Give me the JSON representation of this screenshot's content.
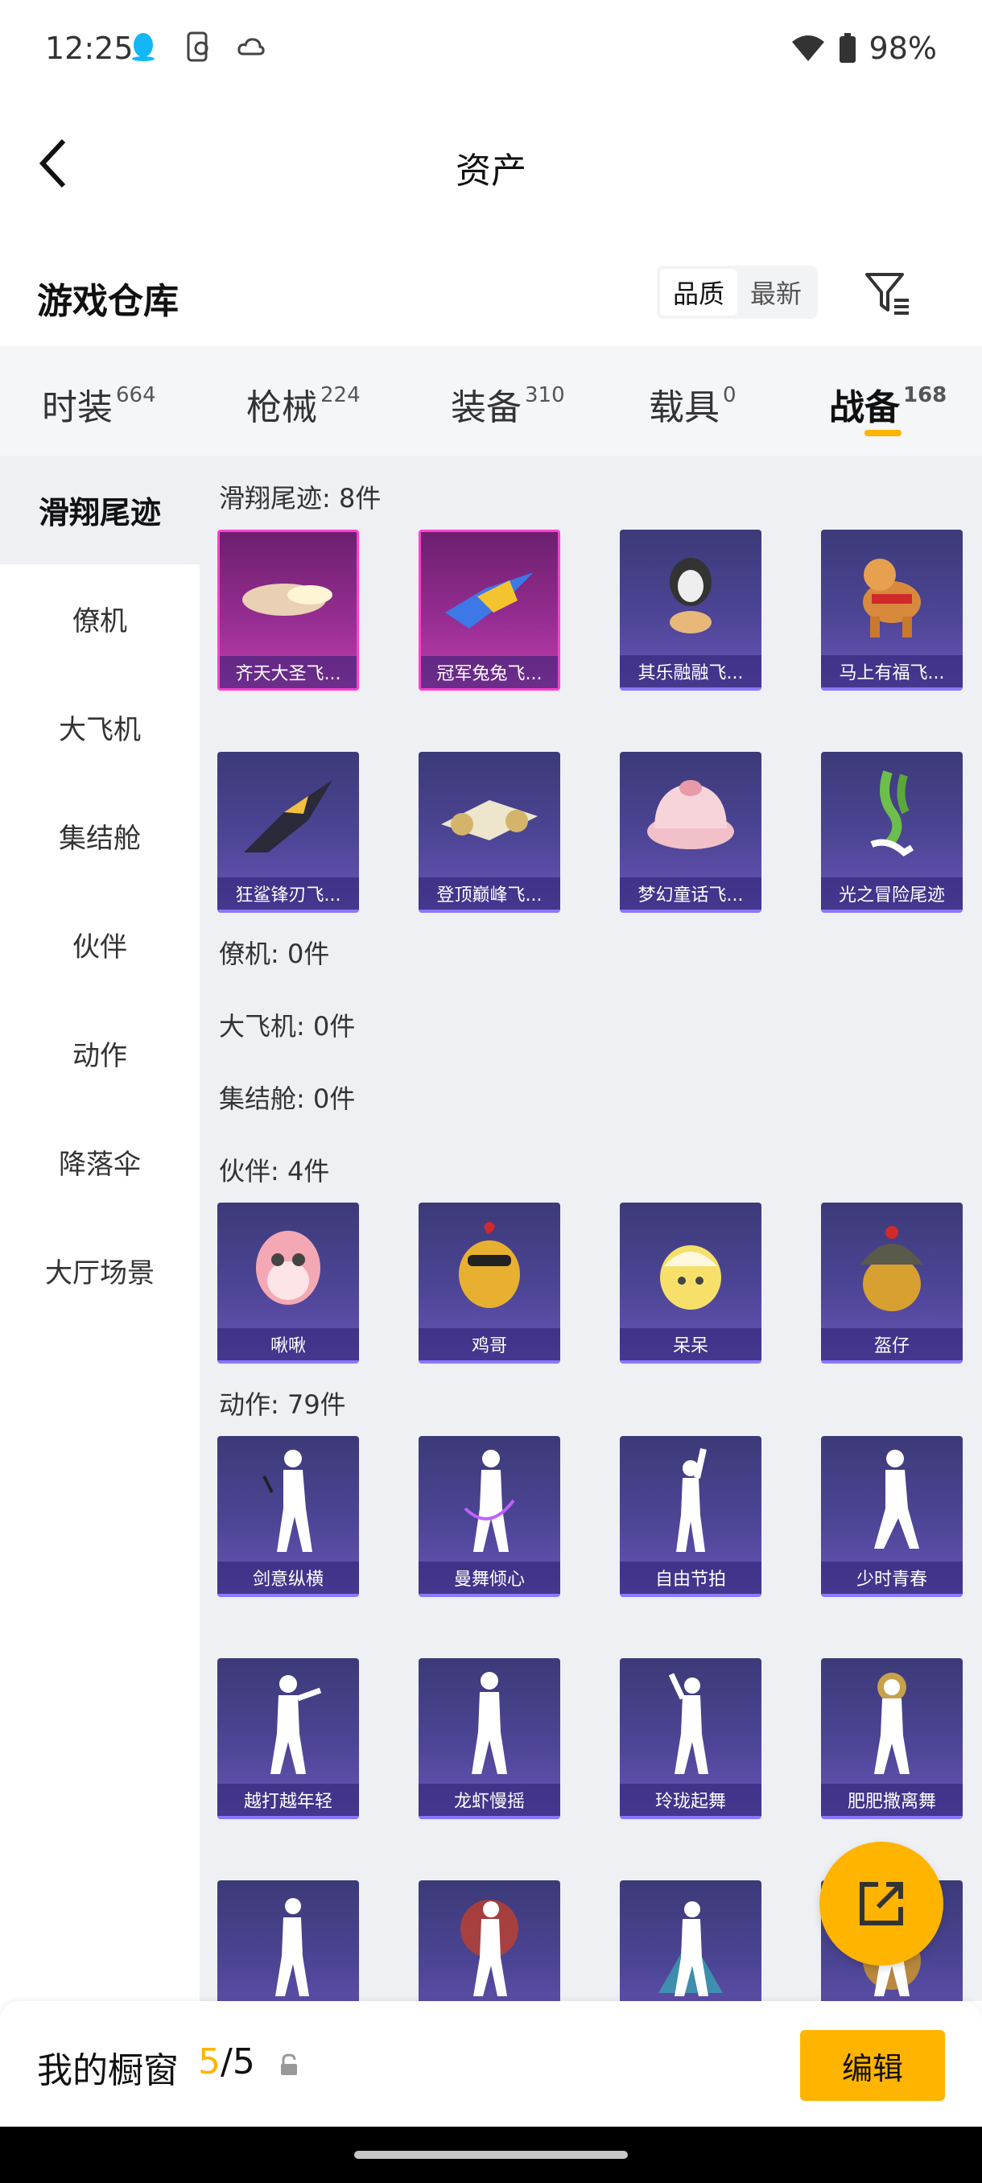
{
  "status_bar": {
    "time": "12:25",
    "battery": "98%"
  },
  "header": {
    "title": "资产"
  },
  "warehouse": {
    "title": "游戏仓库",
    "sort_options": [
      "品质",
      "最新"
    ],
    "active_sort": "品质"
  },
  "tabs": [
    {
      "label": "时装",
      "count": "664"
    },
    {
      "label": "枪械",
      "count": "224"
    },
    {
      "label": "装备",
      "count": "310"
    },
    {
      "label": "载具",
      "count": "0"
    },
    {
      "label": "战备",
      "count": "168",
      "active": true
    }
  ],
  "side_nav": [
    "滑翔尾迹",
    "僚机",
    "大飞机",
    "集结舱",
    "伙伴",
    "动作",
    "降落伞",
    "大厅场景"
  ],
  "sections": {
    "glide": {
      "title": "滑翔尾迹: 8件",
      "items": [
        "齐天大圣飞...",
        "冠军兔兔飞...",
        "其乐融融飞...",
        "马上有福飞...",
        "狂鲨锋刃飞...",
        "登顶巅峰飞...",
        "梦幻童话飞...",
        "光之冒险尾迹"
      ]
    },
    "wingman": {
      "title": "僚机: 0件"
    },
    "bigplane": {
      "title": "大飞机: 0件"
    },
    "capsule": {
      "title": "集结舱: 0件"
    },
    "partner": {
      "title": "伙伴: 4件",
      "items": [
        "啾啾",
        "鸡哥",
        "呆呆",
        "盔仔"
      ]
    },
    "emote": {
      "title": "动作: 79件",
      "items": [
        "剑意纵横",
        "曼舞倾心",
        "自由节拍",
        "少时青春",
        "越打越年轻",
        "龙虾慢摇",
        "玲珑起舞",
        "肥肥撒离舞"
      ]
    }
  },
  "bottom": {
    "showcase_label": "我的橱窗",
    "current": "5",
    "total": "/5",
    "edit_label": "编辑"
  },
  "colors": {
    "accent": "#ffb400",
    "item_bg": "#4d4596",
    "item_pink": "#9a2e94"
  }
}
